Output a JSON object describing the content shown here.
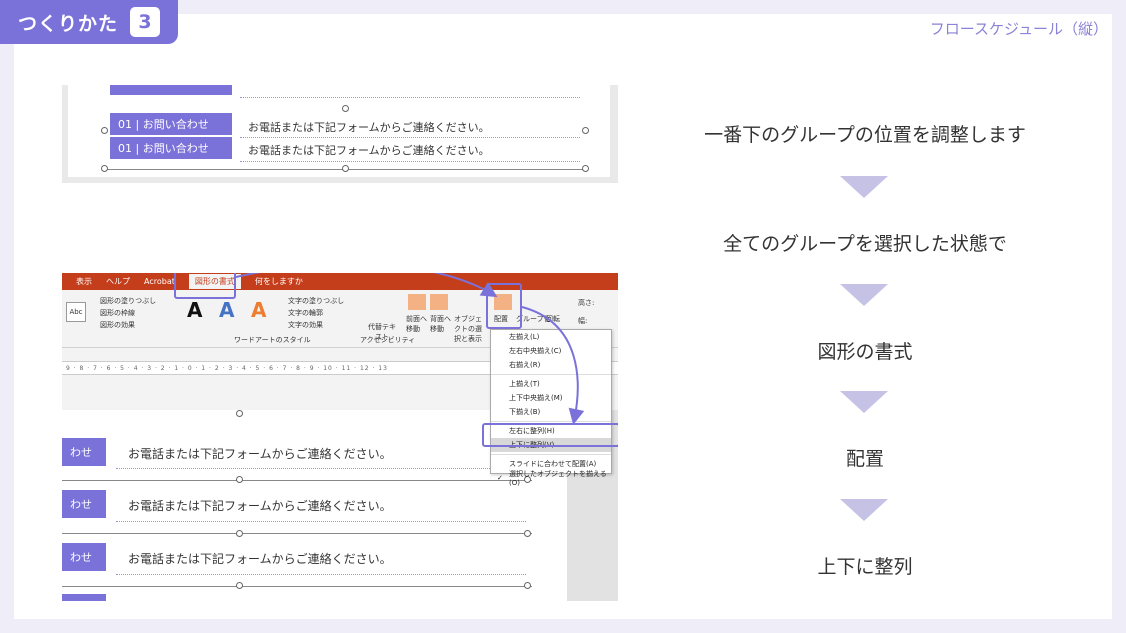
{
  "header": {
    "badge_text": "つくりかた",
    "badge_number": "3",
    "subtitle": "フロースケジュール（縦）"
  },
  "shot1": {
    "rows": [
      {
        "num": "01",
        "label": "お問い合わせ",
        "text": "お電話または下記フォームからご連絡ください。"
      },
      {
        "num": "01",
        "label": "お問い合わせ",
        "text": "お電話または下記フォームからご連絡ください。"
      }
    ]
  },
  "shot2": {
    "tabs": [
      "表示",
      "ヘルプ",
      "Acrobat",
      "図形の書式",
      "何をしますか"
    ],
    "ribbon": {
      "abc": "Abc",
      "shape_fill": "図形の塗りつぶし",
      "shape_outline": "図形の枠線",
      "shape_effects": "図形の効果",
      "wordart_label": "ワードアートのスタイル",
      "text_fill": "文字の塗りつぶし",
      "text_outline": "文字の輪郭",
      "text_effects": "文字の効果",
      "alt_text": "代替テキスト",
      "accessibility": "アクセシビリティ",
      "bring_forward": "前面へ移動",
      "send_backward": "背面へ移動",
      "selection_pane": "オブジェクトの選択と表示",
      "arrange": "配置",
      "group": "グループ化",
      "rotate": "回転",
      "height": "高さ:",
      "width": "幅:"
    },
    "ruler": "9 · 8 · 7 · 6 · 5 · 4 · 3 · 2 · 1 · 0 · 1 · 2 · 3 · 4 · 5 · 6 · 7 · 8 · 9 · 10 · 11 · 12 · 13",
    "menu": [
      "左揃え(L)",
      "左右中央揃え(C)",
      "右揃え(R)",
      "上揃え(T)",
      "上下中央揃え(M)",
      "下揃え(B)",
      "左右に整列(H)",
      "上下に整列(V)",
      "スライドに合わせて配置(A)",
      "選択したオブジェクトを揃える(O)"
    ],
    "rows": [
      {
        "label": "わせ",
        "text": "お電話または下記フォームからご連絡ください。"
      },
      {
        "label": "わせ",
        "text": "お電話または下記フォームからご連絡ください。"
      },
      {
        "label": "わせ",
        "text": "お電話または下記フォームからご連絡ください。"
      }
    ]
  },
  "steps": [
    "一番下のグループの位置を調整します",
    "全てのグループを選択した状態で",
    "図形の書式",
    "配置",
    "上下に整列"
  ],
  "colors": {
    "accent": "#7b72d9",
    "arrow": "#c5c2e6",
    "background": "#eeedf8"
  }
}
